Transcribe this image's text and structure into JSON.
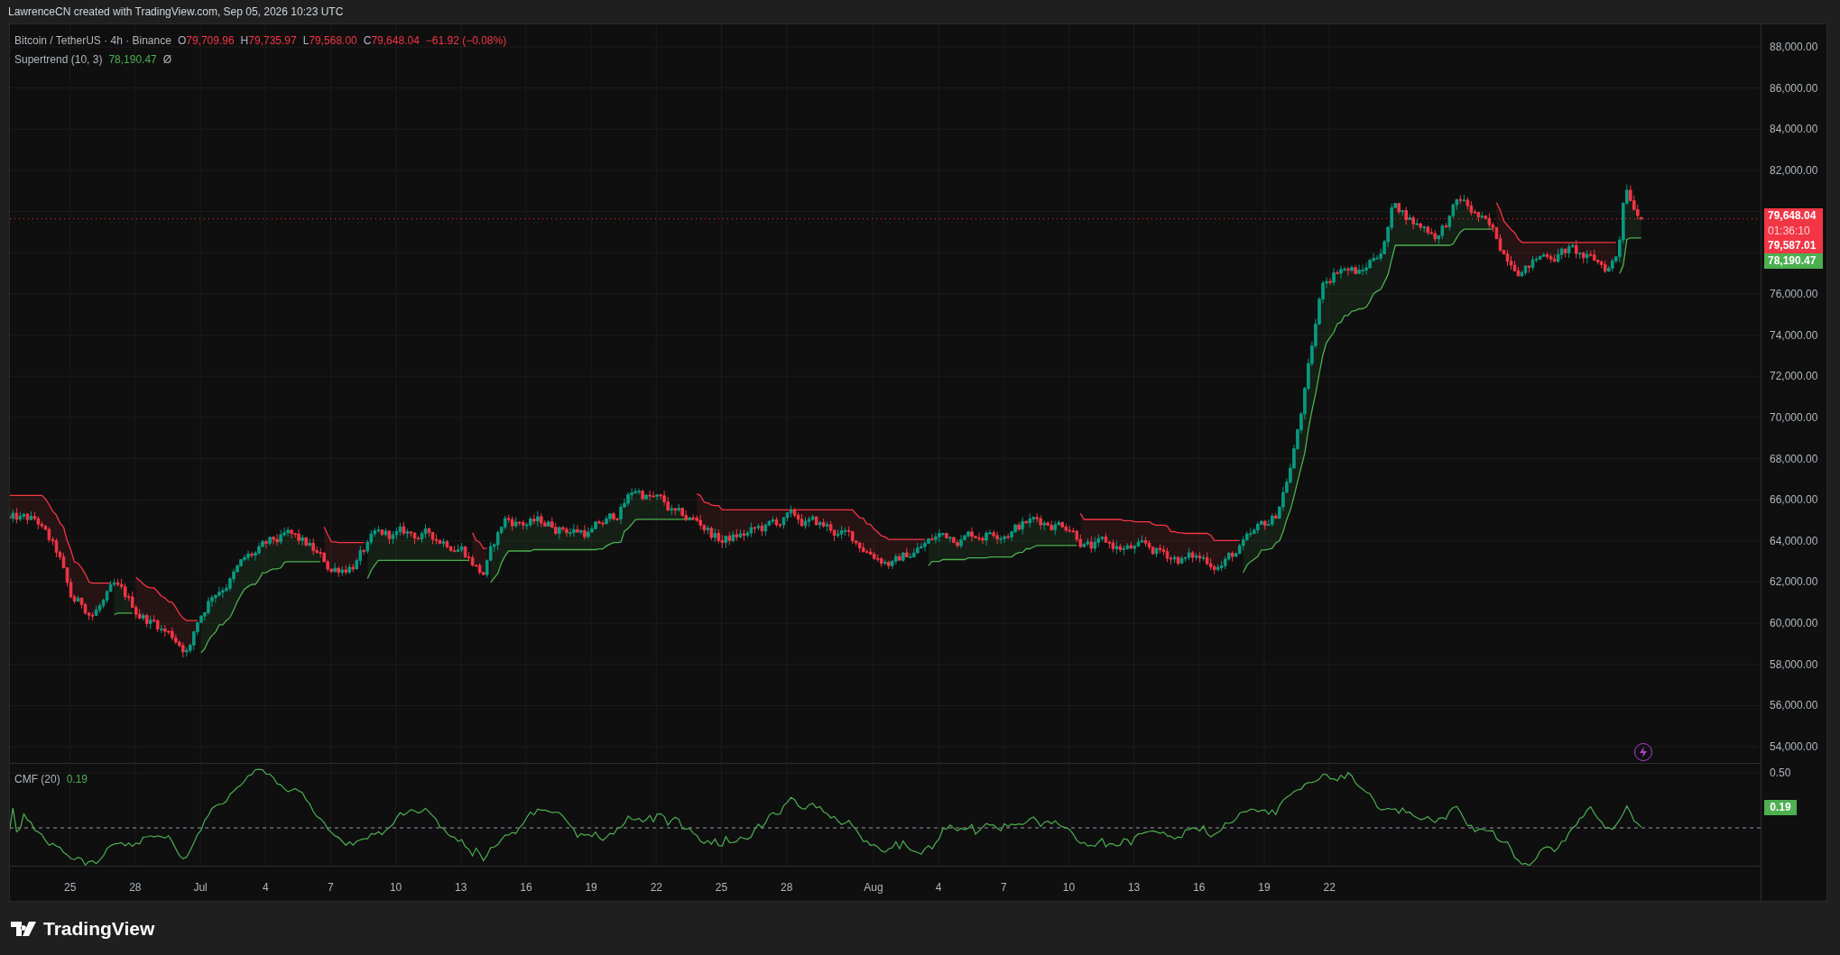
{
  "header": {
    "title": "LawrenceCN created with TradingView.com, Sep 05, 2026 10:23 UTC"
  },
  "legend": {
    "symbol": "Bitcoin / TetherUS · 4h · Binance",
    "ohlc": [
      {
        "label": "O",
        "value": "79,709.96"
      },
      {
        "label": "H",
        "value": "79,735.97"
      },
      {
        "label": "L",
        "value": "79,568.00"
      },
      {
        "label": "C",
        "value": "79,648.04"
      }
    ],
    "change": "−61.92 (−0.08%)"
  },
  "indicator": {
    "name": "Supertrend (10, 3)",
    "value": "78,190.47",
    "symbol": "Ø"
  },
  "price_axis": [
    "88,000.00",
    "86,000.00",
    "84,000.00",
    "82,000.00",
    "76,000.00",
    "74,000.00",
    "72,000.00",
    "70,000.00",
    "68,000.00",
    "66,000.00",
    "64,000.00",
    "62,000.00",
    "60,000.00",
    "58,000.00",
    "56,000.00",
    "54,000.00"
  ],
  "price_tags": [
    {
      "kind": "price",
      "value": "79,648.04",
      "color": "#f23645"
    },
    {
      "kind": "countdown",
      "value": "01:36:10",
      "color": "#f23645"
    },
    {
      "kind": "price",
      "value": "79,587.01",
      "color": "#f23645"
    },
    {
      "kind": "price",
      "value": "78,190.47",
      "color": "#4caf50"
    }
  ],
  "cmf": {
    "name": "CMF (20)",
    "value": "0.19",
    "axis_label": "0.50",
    "tag": "0.19"
  },
  "time_axis": [
    "25",
    "28",
    "Jul",
    "4",
    "7",
    "10",
    "13",
    "16",
    "19",
    "22",
    "25",
    "28",
    "Aug",
    "4",
    "7",
    "10",
    "13",
    "16",
    "19",
    "22"
  ],
  "footer": {
    "brand": "TradingView"
  }
}
